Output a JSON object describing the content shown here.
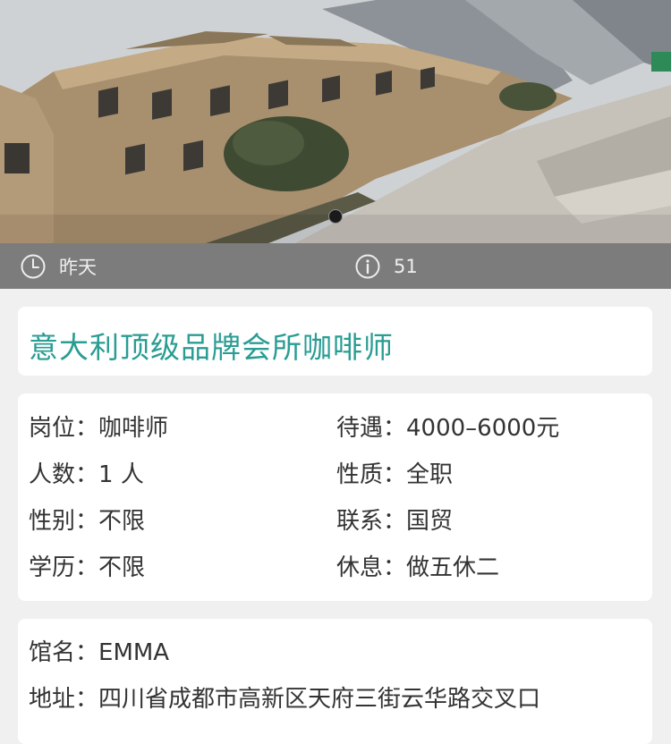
{
  "meta": {
    "posted": "昨天",
    "views": "51",
    "posted_icon": "clock-icon",
    "views_icon": "info-icon"
  },
  "job": {
    "title": "意大利顶级品牌会所咖啡师"
  },
  "details": {
    "position_label": "岗位：",
    "position_value": "咖啡师",
    "salary_label": "待遇：",
    "salary_value": "4000–6000元",
    "headcount_label": "人数：",
    "headcount_value": "1 人",
    "type_label": "性质：",
    "type_value": "全职",
    "gender_label": "性别：",
    "gender_value": "不限",
    "contact_label": "联系：",
    "contact_value": "国贸",
    "education_label": "学历：",
    "education_value": "不限",
    "rest_label": "休息：",
    "rest_value": "做五休二"
  },
  "venue": {
    "name_label": "馆名：",
    "name_value": "EMMA",
    "address_label": "地址：",
    "address_value": "四川省成都市高新区天府三街云华路交叉口"
  },
  "colors": {
    "accent": "#2a9d93",
    "meta_bar": "#7c7c7c",
    "background": "#f0f0f0"
  }
}
